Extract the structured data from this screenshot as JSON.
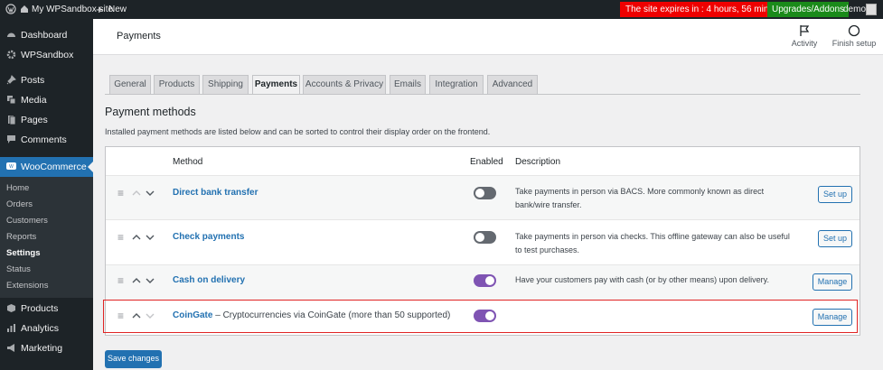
{
  "adminbar": {
    "site_name": "My WPSandbox site",
    "new_label": "New",
    "expire_text": "The site expires in : 4 hours, 56 minutes",
    "upgrade_label": "Upgrades/Addons",
    "user": "demo"
  },
  "sidebar": {
    "items": [
      {
        "label": "Dashboard",
        "icon": "dashboard-icon"
      },
      {
        "label": "WPSandbox",
        "icon": "gear-icon"
      },
      {
        "label": "Posts",
        "icon": "pin-icon"
      },
      {
        "label": "Media",
        "icon": "media-icon"
      },
      {
        "label": "Pages",
        "icon": "pages-icon"
      },
      {
        "label": "Comments",
        "icon": "comment-icon"
      },
      {
        "label": "WooCommerce",
        "icon": "woo-icon"
      },
      {
        "label": "Products",
        "icon": "products-icon"
      },
      {
        "label": "Analytics",
        "icon": "analytics-icon"
      },
      {
        "label": "Marketing",
        "icon": "megaphone-icon"
      }
    ],
    "submenu": [
      "Home",
      "Orders",
      "Customers",
      "Reports",
      "Settings",
      "Status",
      "Extensions"
    ]
  },
  "header": {
    "title": "Payments",
    "activity_label": "Activity",
    "finish_label": "Finish setup"
  },
  "tabs": [
    "General",
    "Products",
    "Shipping",
    "Payments",
    "Accounts & Privacy",
    "Emails",
    "Integration",
    "Advanced"
  ],
  "section": {
    "title": "Payment methods",
    "description": "Installed payment methods are listed below and can be sorted to control their display order on the frontend."
  },
  "table": {
    "headers": {
      "method": "Method",
      "enabled": "Enabled",
      "description": "Description"
    },
    "rows": [
      {
        "name": "Direct bank transfer",
        "extra": "",
        "enabled": false,
        "description": "Take payments in person via BACS. More commonly known as direct bank/wire transfer.",
        "action": "Set up"
      },
      {
        "name": "Check payments",
        "extra": "",
        "enabled": false,
        "description": "Take payments in person via checks. This offline gateway can also be useful to test purchases.",
        "action": "Set up"
      },
      {
        "name": "Cash on delivery",
        "extra": "",
        "enabled": true,
        "description": "Have your customers pay with cash (or by other means) upon delivery.",
        "action": "Manage"
      },
      {
        "name": "CoinGate",
        "extra": " – Cryptocurrencies via CoinGate (more than 50 supported)",
        "enabled": true,
        "description": "",
        "action": "Manage"
      }
    ]
  },
  "save_label": "Save changes",
  "colors": {
    "accent": "#2271b1",
    "toggle_on": "#7f54b3",
    "highlight": "#e02424"
  }
}
